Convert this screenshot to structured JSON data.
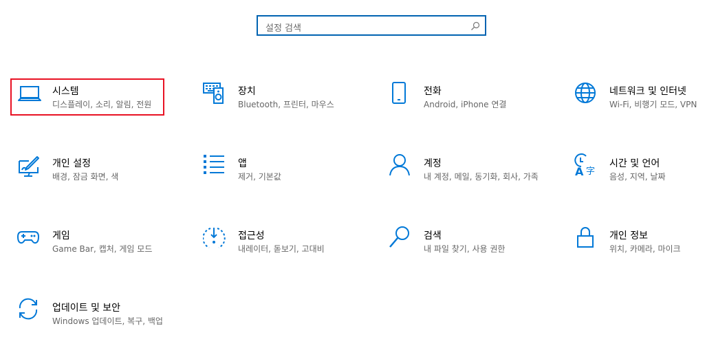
{
  "search": {
    "placeholder": "설정 검색",
    "icon": "search-icon"
  },
  "accent_color": "#0078d7",
  "tiles": [
    {
      "title": "시스템",
      "desc": "디스플레이, 소리, 알림, 전원",
      "icon": "laptop-icon",
      "selected": true
    },
    {
      "title": "장치",
      "desc": "Bluetooth, 프린터, 마우스",
      "icon": "devices-icon"
    },
    {
      "title": "전화",
      "desc": "Android, iPhone 연결",
      "icon": "phone-icon"
    },
    {
      "title": "네트워크 및 인터넷",
      "desc": "Wi-Fi, 비행기 모드, VPN",
      "icon": "globe-icon"
    },
    {
      "title": "개인 설정",
      "desc": "배경, 잠금 화면, 색",
      "icon": "personalization-icon"
    },
    {
      "title": "앱",
      "desc": "제거, 기본값",
      "icon": "apps-icon"
    },
    {
      "title": "계정",
      "desc": "내 계정, 메일, 동기화, 회사, 가족",
      "icon": "person-icon"
    },
    {
      "title": "시간 및 언어",
      "desc": "음성, 지역, 날짜",
      "icon": "time-language-icon"
    },
    {
      "title": "게임",
      "desc": "Game Bar, 캡처, 게임 모드",
      "icon": "gamepad-icon"
    },
    {
      "title": "접근성",
      "desc": "내레이터, 돋보기, 고대비",
      "icon": "ease-of-access-icon"
    },
    {
      "title": "검색",
      "desc": "내 파일 찾기, 사용 권한",
      "icon": "search-category-icon"
    },
    {
      "title": "개인 정보",
      "desc": "위치, 카메라, 마이크",
      "icon": "lock-icon"
    },
    {
      "title": "업데이트 및 보안",
      "desc": "Windows 업데이트, 복구, 백업",
      "icon": "update-icon"
    }
  ]
}
